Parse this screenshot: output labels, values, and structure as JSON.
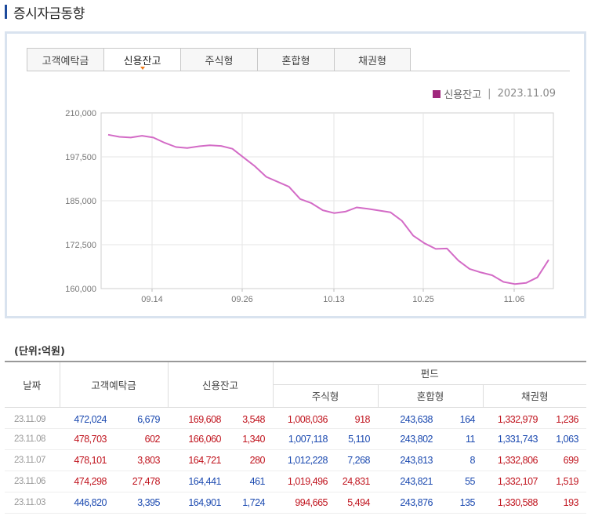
{
  "title": "증시자금동향",
  "tabs": [
    "고객예탁금",
    "신용잔고",
    "주식형",
    "혼합형",
    "채권형"
  ],
  "active_tab": "신용잔고",
  "legend": {
    "series": "신용잔고",
    "date": "2023.11.09",
    "color": "#a0287d"
  },
  "chart_data": {
    "type": "line",
    "ylim": [
      160000,
      210000
    ],
    "yticks": [
      "210,000",
      "197,500",
      "185,000",
      "172,500",
      "160,000"
    ],
    "xticks": [
      "09.14",
      "09.26",
      "10.13",
      "10.25",
      "11.06"
    ],
    "series": [
      {
        "name": "신용잔고",
        "values": [
          203800,
          203200,
          203000,
          203500,
          203000,
          201500,
          200300,
          200000,
          200500,
          200800,
          200600,
          199800,
          197300,
          194800,
          191800,
          190400,
          189000,
          185500,
          184300,
          182300,
          181500,
          181900,
          183100,
          182700,
          182200,
          181700,
          179300,
          175100,
          172900,
          171300,
          171400,
          168000,
          165600,
          164600,
          163800,
          161900,
          161300,
          161600,
          163200,
          168200
        ]
      }
    ],
    "line_color": "#d36bc6"
  },
  "unit_label": "(단위:억원)",
  "table": {
    "headers": {
      "date": "날짜",
      "deposit": "고객예탁금",
      "credit": "신용잔고",
      "fund": "펀드",
      "equity": "주식형",
      "mixed": "혼합형",
      "bond": "채권형"
    },
    "rows": [
      {
        "date": "23.11.09",
        "dep": "472,024",
        "dep_chg": "6,679",
        "cr": "169,608",
        "cr_chg": "3,548",
        "eq": "1,008,036",
        "eq_chg": "918",
        "mx": "243,638",
        "mx_chg": "164",
        "bd": "1,332,979",
        "bd_chg": "1,236"
      },
      {
        "date": "23.11.08",
        "dep": "478,703",
        "dep_chg": "602",
        "cr": "166,060",
        "cr_chg": "1,340",
        "eq": "1,007,118",
        "eq_chg": "5,110",
        "mx": "243,802",
        "mx_chg": "11",
        "bd": "1,331,743",
        "bd_chg": "1,063"
      },
      {
        "date": "23.11.07",
        "dep": "478,101",
        "dep_chg": "3,803",
        "cr": "164,721",
        "cr_chg": "280",
        "eq": "1,012,228",
        "eq_chg": "7,268",
        "mx": "243,813",
        "mx_chg": "8",
        "bd": "1,332,806",
        "bd_chg": "699"
      },
      {
        "date": "23.11.06",
        "dep": "474,298",
        "dep_chg": "27,478",
        "cr": "164,441",
        "cr_chg": "461",
        "eq": "1,019,496",
        "eq_chg": "24,831",
        "mx": "243,821",
        "mx_chg": "55",
        "bd": "1,332,107",
        "bd_chg": "1,519"
      },
      {
        "date": "23.11.03",
        "dep": "446,820",
        "dep_chg": "3,395",
        "cr": "164,901",
        "cr_chg": "1,724",
        "eq": "994,665",
        "eq_chg": "5,494",
        "mx": "243,876",
        "mx_chg": "135",
        "bd": "1,330,588",
        "bd_chg": "193"
      }
    ],
    "colors": [
      [
        "blu",
        "blu",
        "red",
        "red",
        "red",
        "red",
        "blu",
        "blu",
        "red",
        "red"
      ],
      [
        "red",
        "red",
        "red",
        "red",
        "blu",
        "blu",
        "blu",
        "blu",
        "blu",
        "blu"
      ],
      [
        "red",
        "red",
        "red",
        "red",
        "blu",
        "blu",
        "blu",
        "blu",
        "red",
        "red"
      ],
      [
        "red",
        "red",
        "blu",
        "blu",
        "red",
        "red",
        "blu",
        "blu",
        "red",
        "red"
      ],
      [
        "blu",
        "blu",
        "blu",
        "blu",
        "red",
        "red",
        "blu",
        "blu",
        "red",
        "red"
      ]
    ]
  }
}
